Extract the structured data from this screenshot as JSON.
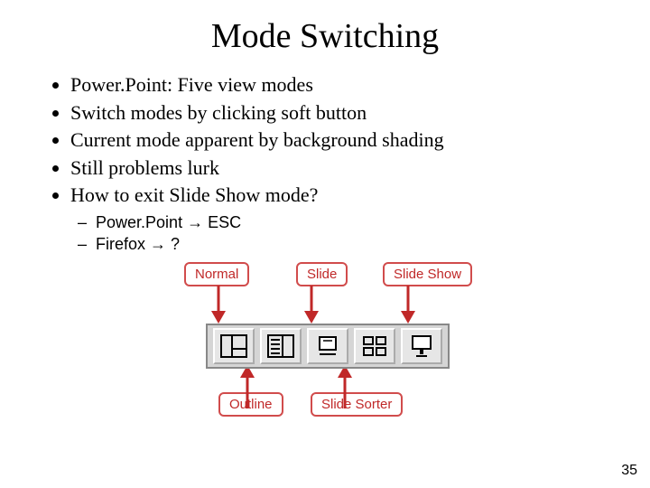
{
  "title": "Mode Switching",
  "bullets": [
    "Power.Point: Five view modes",
    "Switch modes by clicking soft button",
    "Current mode apparent by background shading",
    "Still problems lurk",
    "How to exit Slide Show mode?"
  ],
  "sub_bullets": [
    "Power.Point → ESC",
    "Firefox → ?"
  ],
  "labels": {
    "normal": "Normal",
    "slide": "Slide",
    "slideshow": "Slide Show",
    "outline": "Outline",
    "sorter": "Slide Sorter"
  },
  "page_number": "35"
}
